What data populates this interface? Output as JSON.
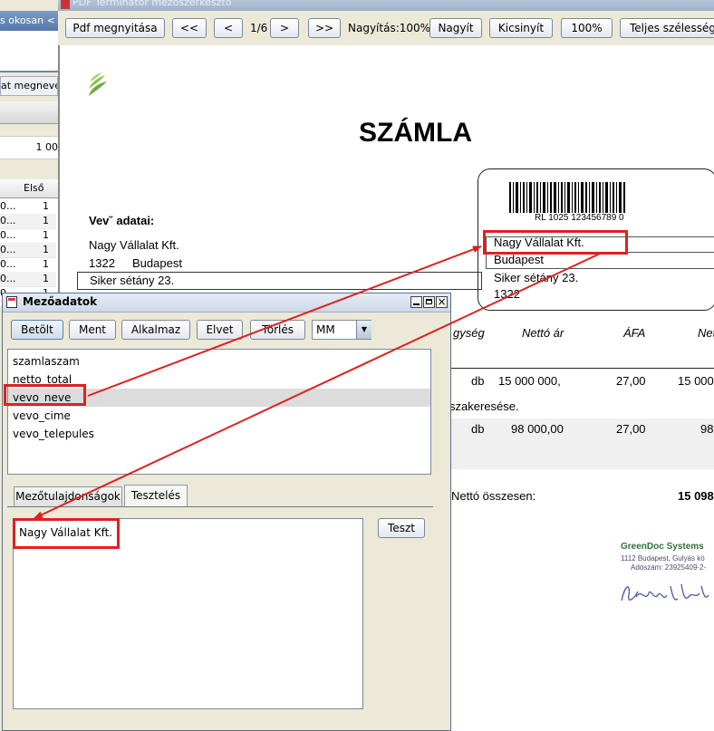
{
  "left_panel": {
    "title_partial": "s okosan <",
    "header_partial": "at megneve",
    "value_partial": "1 00",
    "column_header": "Első",
    "rows": [
      {
        "a": "0...",
        "b": "1"
      },
      {
        "a": "0...",
        "b": "1"
      },
      {
        "a": "0...",
        "b": "1"
      },
      {
        "a": "0...",
        "b": "1"
      },
      {
        "a": "0...",
        "b": "1"
      },
      {
        "a": "0...",
        "b": "1"
      },
      {
        "a": "0...",
        "b": "1"
      }
    ]
  },
  "viewer": {
    "title": "PDF Terminátor mezőszerkesztő",
    "toolbar": {
      "open_label": "Pdf megnyitása",
      "first_label": "<<",
      "prev_label": "<",
      "page_indicator": "1/6",
      "next_label": ">",
      "last_label": ">>",
      "zoom_label": "Nagyítás:100%",
      "zoom_in_label": "Nagyít",
      "zoom_out_label": "Kicsinyít",
      "zoom_100_label": "100%",
      "fit_width_label": "Teljes szélesség"
    }
  },
  "document": {
    "title": "SZÁMLA",
    "buyer_heading": "Vev˘ adatai:",
    "buyer_name": "Nagy Vállalat Kft.",
    "buyer_zip": "1322",
    "buyer_city": "Budapest",
    "buyer_street": "Siker sétány 23.",
    "barcode_text": "RL 1025 123456789 0",
    "box_name": "Nagy Vállalat Kft.",
    "box_city": "Budapest",
    "box_street": "Siker sétány 23.",
    "box_zip": "1322",
    "table_headers": [
      "gység",
      "Nettó ár",
      "ÁFA",
      "Nettó öss"
    ],
    "rows": [
      {
        "unit": "db",
        "price": "15 000 000,",
        "vat": "27,00",
        "net": "15 000"
      },
      {
        "unit": "db",
        "price": "98 000,00",
        "vat": "27,00",
        "net": "98"
      }
    ],
    "row1_note": "szakeresése.",
    "net_total_label": "Nettó összesen:",
    "net_total_value": "15 098",
    "company_name": "GreenDoc Systems",
    "company_address": "1112 Budapest, Gulyás kö",
    "company_tax": "Adószám: 23925409-2-"
  },
  "dialog": {
    "title": "Mezőadatok",
    "buttons": {
      "load": "Betölt",
      "save": "Ment",
      "apply": "Alkalmaz",
      "discard": "Elvet",
      "delete": "Törlés"
    },
    "select_value": "MM",
    "fields": [
      "szamlaszam",
      "netto_total",
      "vevo_neve",
      "vevo_cime",
      "vevo_telepules"
    ],
    "selected_index": 2,
    "tabs": [
      "Mezőtulajdonságok",
      "Tesztelés"
    ],
    "active_tab": 1,
    "test_result": "Nagy Vállalat Kft.",
    "test_button": "Teszt"
  }
}
